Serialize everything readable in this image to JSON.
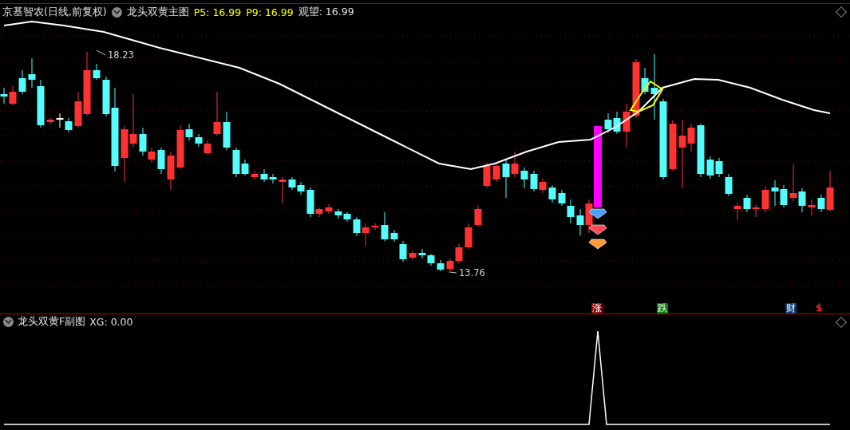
{
  "header": {
    "stock": "京基智农(日线,前复权)",
    "indicator": "龙头双黄主图",
    "values": [
      {
        "text": "P5: 16.99",
        "color": "#ffff00"
      },
      {
        "text": "P9: 16.99",
        "color": "#ffff00"
      },
      {
        "text": "观望: 16.99",
        "color": "#e0e0e0"
      }
    ]
  },
  "price_labels": [
    {
      "text": "18.23",
      "kind": "high"
    },
    {
      "text": "13.76",
      "kind": "low"
    }
  ],
  "signals": [
    {
      "text": "涨",
      "color": "#8b0000"
    },
    {
      "text": "跌",
      "color": "#008000"
    },
    {
      "text": "财",
      "color": "#0a3a6e"
    },
    {
      "text": "$",
      "color": "#ff2020",
      "kind": "glyph"
    }
  ],
  "sub": {
    "title": "龙头双黄F副图",
    "reading": "XG: 0.00"
  }
}
